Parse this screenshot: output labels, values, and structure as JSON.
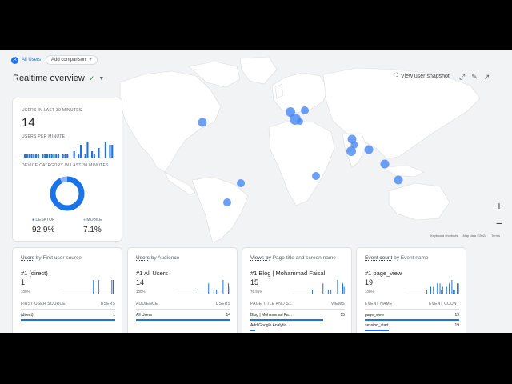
{
  "header": {
    "segment_label": "All Users",
    "segment_letter": "A",
    "add_comparison_label": "Add comparison",
    "page_title": "Realtime overview",
    "view_snapshot_label": "View user snapshot"
  },
  "map": {
    "keyboard_shortcuts": "Keyboard shortcuts",
    "map_data": "Map data ©2024",
    "terms": "Terms",
    "zoom_in": "+",
    "zoom_out": "−"
  },
  "summary": {
    "users_label": "USERS IN LAST 30 MINUTES",
    "users_value": "14",
    "per_minute_label": "USERS PER MINUTE",
    "per_minute_values": [
      1,
      1,
      1,
      1,
      1,
      1,
      1,
      0,
      1,
      1,
      1,
      1,
      1,
      1,
      1,
      1,
      0,
      1,
      1,
      1,
      0,
      0,
      2,
      0,
      1,
      4,
      0,
      1,
      5,
      0,
      2,
      1,
      0,
      3,
      0,
      0,
      5,
      0,
      4,
      4
    ],
    "device_label": "DEVICE CATEGORY IN LAST 30 MINUTES",
    "device": [
      {
        "name": "DESKTOP",
        "value": "92.9%",
        "fraction": 0.929,
        "color": "#1a73e8"
      },
      {
        "name": "MOBILE",
        "value": "7.1%",
        "fraction": 0.071,
        "color": "#8ab4f8"
      }
    ]
  },
  "panels": [
    {
      "title_pre": "Users",
      "title_dim": "by First user source",
      "rank": "#1  (direct)",
      "count": "1",
      "pct": "100%",
      "col1": "FIRST USER SOURCE",
      "col2": "USERS",
      "mini": [
        0,
        0,
        0,
        0,
        0,
        0,
        0,
        0,
        0,
        0,
        0,
        0,
        0,
        0,
        0,
        0,
        0,
        0,
        0,
        0,
        0,
        0,
        0,
        1,
        0,
        0,
        0,
        1,
        0,
        0,
        0,
        0,
        0,
        0,
        0,
        0,
        0,
        1,
        1,
        0
      ],
      "rows": [
        {
          "name": "(direct)",
          "value": "1",
          "fraction": 1.0
        }
      ]
    },
    {
      "title_pre": "Users",
      "title_dim": "by Audience",
      "rank": "#1  All Users",
      "count": "14",
      "pct": "100%",
      "col1": "AUDIENCE",
      "col2": "USERS",
      "mini": [
        0,
        0,
        0,
        0,
        0,
        0,
        0,
        0,
        0,
        0,
        0,
        0,
        0,
        0,
        0,
        1,
        0,
        0,
        0,
        0,
        0,
        0,
        0,
        3,
        0,
        0,
        0,
        1,
        0,
        1,
        0,
        0,
        0,
        0,
        4,
        0,
        0,
        0,
        3,
        2
      ],
      "rows": [
        {
          "name": "All Users",
          "value": "14",
          "fraction": 1.0
        }
      ]
    },
    {
      "title_pre": "Views by",
      "title_dim": "Page title and screen name",
      "rank": "#1  Blog | Mohammad Faisal",
      "count": "15",
      "pct": "76.95%",
      "col1": "PAGE TITLE AND S...",
      "col2": "VIEWS",
      "mini": [
        0,
        0,
        0,
        0,
        0,
        0,
        0,
        0,
        0,
        0,
        0,
        0,
        0,
        0,
        0,
        1,
        0,
        0,
        0,
        0,
        0,
        0,
        0,
        3,
        0,
        0,
        0,
        1,
        0,
        1,
        0,
        0,
        0,
        0,
        4,
        0,
        0,
        0,
        3,
        2
      ],
      "rows": [
        {
          "name": "Blog | Mohammad Fa...",
          "value": "15",
          "fraction": 0.77
        },
        {
          "name": "Add Google Analytic...",
          "value": "",
          "fraction": 0.05
        }
      ]
    },
    {
      "title_pre": "Event count",
      "title_dim": "by Event name",
      "rank": "#1  page_view",
      "count": "19",
      "pct": "100%",
      "col1": "EVENT NAME",
      "col2": "EVENT COUNT",
      "mini": [
        0,
        0,
        0,
        0,
        0,
        0,
        0,
        0,
        0,
        0,
        0,
        0,
        0,
        0,
        0,
        1,
        0,
        0,
        2,
        0,
        2,
        0,
        0,
        3,
        0,
        3,
        1,
        2,
        0,
        0,
        2,
        0,
        3,
        0,
        4,
        1,
        1,
        0,
        3,
        3
      ],
      "rows": [
        {
          "name": "page_view",
          "value": "19",
          "fraction": 1.0
        },
        {
          "name": "session_start",
          "value": "19",
          "fraction": 0.25
        }
      ]
    }
  ]
}
